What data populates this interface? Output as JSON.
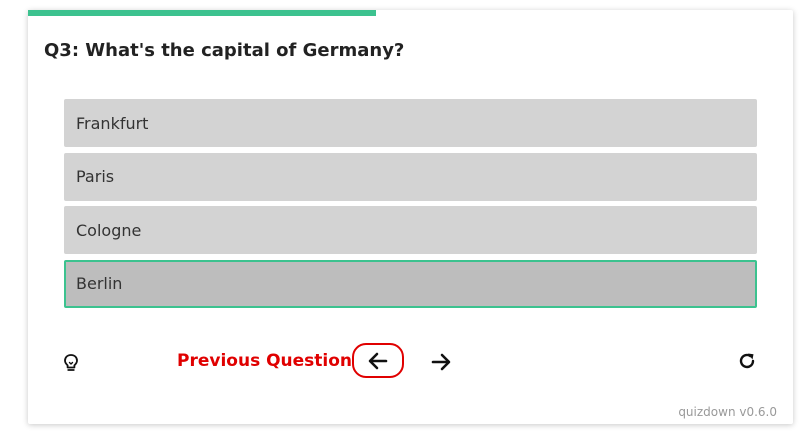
{
  "progress": {
    "fraction": 0.455,
    "color": "#3cc28f"
  },
  "question": {
    "text": "Q3: What's the capital of Germany?"
  },
  "answers": [
    {
      "label": "Frankfurt",
      "selected": false
    },
    {
      "label": "Paris",
      "selected": false
    },
    {
      "label": "Cologne",
      "selected": false
    },
    {
      "label": "Berlin",
      "selected": true
    }
  ],
  "footer": {
    "hint_icon": "lightbulb-icon",
    "previous_label": "Previous Question",
    "previous_icon": "arrow-left-icon",
    "next_icon": "arrow-right-icon",
    "reset_icon": "reload-icon"
  },
  "version": "quizdown v0.6.0",
  "colors": {
    "accent": "#3cc28f",
    "warning": "#e00000",
    "answer_bg": "#d3d3d3",
    "answer_selected_bg": "#bdbdbd"
  }
}
